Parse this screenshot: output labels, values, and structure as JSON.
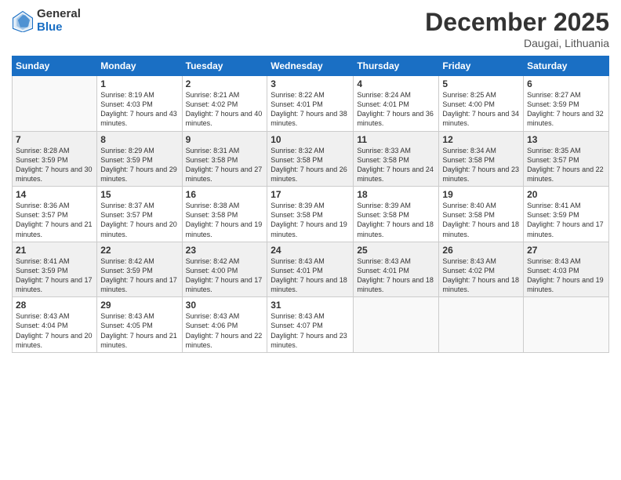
{
  "header": {
    "logo_general": "General",
    "logo_blue": "Blue",
    "month_title": "December 2025",
    "location": "Daugai, Lithuania"
  },
  "days_of_week": [
    "Sunday",
    "Monday",
    "Tuesday",
    "Wednesday",
    "Thursday",
    "Friday",
    "Saturday"
  ],
  "weeks": [
    {
      "shaded": false,
      "days": [
        {
          "num": "",
          "sunrise": "",
          "sunset": "",
          "daylight": ""
        },
        {
          "num": "1",
          "sunrise": "Sunrise: 8:19 AM",
          "sunset": "Sunset: 4:03 PM",
          "daylight": "Daylight: 7 hours and 43 minutes."
        },
        {
          "num": "2",
          "sunrise": "Sunrise: 8:21 AM",
          "sunset": "Sunset: 4:02 PM",
          "daylight": "Daylight: 7 hours and 40 minutes."
        },
        {
          "num": "3",
          "sunrise": "Sunrise: 8:22 AM",
          "sunset": "Sunset: 4:01 PM",
          "daylight": "Daylight: 7 hours and 38 minutes."
        },
        {
          "num": "4",
          "sunrise": "Sunrise: 8:24 AM",
          "sunset": "Sunset: 4:01 PM",
          "daylight": "Daylight: 7 hours and 36 minutes."
        },
        {
          "num": "5",
          "sunrise": "Sunrise: 8:25 AM",
          "sunset": "Sunset: 4:00 PM",
          "daylight": "Daylight: 7 hours and 34 minutes."
        },
        {
          "num": "6",
          "sunrise": "Sunrise: 8:27 AM",
          "sunset": "Sunset: 3:59 PM",
          "daylight": "Daylight: 7 hours and 32 minutes."
        }
      ]
    },
    {
      "shaded": true,
      "days": [
        {
          "num": "7",
          "sunrise": "Sunrise: 8:28 AM",
          "sunset": "Sunset: 3:59 PM",
          "daylight": "Daylight: 7 hours and 30 minutes."
        },
        {
          "num": "8",
          "sunrise": "Sunrise: 8:29 AM",
          "sunset": "Sunset: 3:59 PM",
          "daylight": "Daylight: 7 hours and 29 minutes."
        },
        {
          "num": "9",
          "sunrise": "Sunrise: 8:31 AM",
          "sunset": "Sunset: 3:58 PM",
          "daylight": "Daylight: 7 hours and 27 minutes."
        },
        {
          "num": "10",
          "sunrise": "Sunrise: 8:32 AM",
          "sunset": "Sunset: 3:58 PM",
          "daylight": "Daylight: 7 hours and 26 minutes."
        },
        {
          "num": "11",
          "sunrise": "Sunrise: 8:33 AM",
          "sunset": "Sunset: 3:58 PM",
          "daylight": "Daylight: 7 hours and 24 minutes."
        },
        {
          "num": "12",
          "sunrise": "Sunrise: 8:34 AM",
          "sunset": "Sunset: 3:58 PM",
          "daylight": "Daylight: 7 hours and 23 minutes."
        },
        {
          "num": "13",
          "sunrise": "Sunrise: 8:35 AM",
          "sunset": "Sunset: 3:57 PM",
          "daylight": "Daylight: 7 hours and 22 minutes."
        }
      ]
    },
    {
      "shaded": false,
      "days": [
        {
          "num": "14",
          "sunrise": "Sunrise: 8:36 AM",
          "sunset": "Sunset: 3:57 PM",
          "daylight": "Daylight: 7 hours and 21 minutes."
        },
        {
          "num": "15",
          "sunrise": "Sunrise: 8:37 AM",
          "sunset": "Sunset: 3:57 PM",
          "daylight": "Daylight: 7 hours and 20 minutes."
        },
        {
          "num": "16",
          "sunrise": "Sunrise: 8:38 AM",
          "sunset": "Sunset: 3:58 PM",
          "daylight": "Daylight: 7 hours and 19 minutes."
        },
        {
          "num": "17",
          "sunrise": "Sunrise: 8:39 AM",
          "sunset": "Sunset: 3:58 PM",
          "daylight": "Daylight: 7 hours and 19 minutes."
        },
        {
          "num": "18",
          "sunrise": "Sunrise: 8:39 AM",
          "sunset": "Sunset: 3:58 PM",
          "daylight": "Daylight: 7 hours and 18 minutes."
        },
        {
          "num": "19",
          "sunrise": "Sunrise: 8:40 AM",
          "sunset": "Sunset: 3:58 PM",
          "daylight": "Daylight: 7 hours and 18 minutes."
        },
        {
          "num": "20",
          "sunrise": "Sunrise: 8:41 AM",
          "sunset": "Sunset: 3:59 PM",
          "daylight": "Daylight: 7 hours and 17 minutes."
        }
      ]
    },
    {
      "shaded": true,
      "days": [
        {
          "num": "21",
          "sunrise": "Sunrise: 8:41 AM",
          "sunset": "Sunset: 3:59 PM",
          "daylight": "Daylight: 7 hours and 17 minutes."
        },
        {
          "num": "22",
          "sunrise": "Sunrise: 8:42 AM",
          "sunset": "Sunset: 3:59 PM",
          "daylight": "Daylight: 7 hours and 17 minutes."
        },
        {
          "num": "23",
          "sunrise": "Sunrise: 8:42 AM",
          "sunset": "Sunset: 4:00 PM",
          "daylight": "Daylight: 7 hours and 17 minutes."
        },
        {
          "num": "24",
          "sunrise": "Sunrise: 8:43 AM",
          "sunset": "Sunset: 4:01 PM",
          "daylight": "Daylight: 7 hours and 18 minutes."
        },
        {
          "num": "25",
          "sunrise": "Sunrise: 8:43 AM",
          "sunset": "Sunset: 4:01 PM",
          "daylight": "Daylight: 7 hours and 18 minutes."
        },
        {
          "num": "26",
          "sunrise": "Sunrise: 8:43 AM",
          "sunset": "Sunset: 4:02 PM",
          "daylight": "Daylight: 7 hours and 18 minutes."
        },
        {
          "num": "27",
          "sunrise": "Sunrise: 8:43 AM",
          "sunset": "Sunset: 4:03 PM",
          "daylight": "Daylight: 7 hours and 19 minutes."
        }
      ]
    },
    {
      "shaded": false,
      "days": [
        {
          "num": "28",
          "sunrise": "Sunrise: 8:43 AM",
          "sunset": "Sunset: 4:04 PM",
          "daylight": "Daylight: 7 hours and 20 minutes."
        },
        {
          "num": "29",
          "sunrise": "Sunrise: 8:43 AM",
          "sunset": "Sunset: 4:05 PM",
          "daylight": "Daylight: 7 hours and 21 minutes."
        },
        {
          "num": "30",
          "sunrise": "Sunrise: 8:43 AM",
          "sunset": "Sunset: 4:06 PM",
          "daylight": "Daylight: 7 hours and 22 minutes."
        },
        {
          "num": "31",
          "sunrise": "Sunrise: 8:43 AM",
          "sunset": "Sunset: 4:07 PM",
          "daylight": "Daylight: 7 hours and 23 minutes."
        },
        {
          "num": "",
          "sunrise": "",
          "sunset": "",
          "daylight": ""
        },
        {
          "num": "",
          "sunrise": "",
          "sunset": "",
          "daylight": ""
        },
        {
          "num": "",
          "sunrise": "",
          "sunset": "",
          "daylight": ""
        }
      ]
    }
  ]
}
